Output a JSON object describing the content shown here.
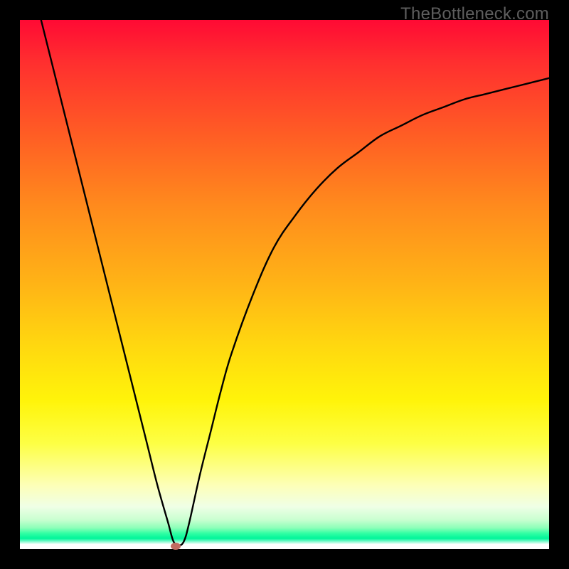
{
  "watermark": "TheBottleneck.com",
  "chart_data": {
    "type": "line",
    "title": "",
    "xlabel": "",
    "ylabel": "",
    "xlim": [
      0,
      100
    ],
    "ylim": [
      0,
      100
    ],
    "grid": false,
    "series": [
      {
        "name": "bottleneck-curve",
        "x": [
          4,
          6,
          8,
          10,
          12,
          14,
          16,
          18,
          20,
          22,
          24,
          26,
          28,
          29,
          30,
          31,
          32,
          34,
          36,
          38,
          40,
          44,
          48,
          52,
          56,
          60,
          64,
          68,
          72,
          76,
          80,
          84,
          88,
          92,
          96,
          100
        ],
        "y": [
          100,
          92,
          84,
          76,
          68,
          60,
          52,
          44,
          36,
          28,
          20,
          12,
          5,
          1.5,
          0.7,
          1.5,
          5,
          14,
          22,
          30,
          37,
          48,
          57,
          63,
          68,
          72,
          75,
          78,
          80,
          82,
          83.5,
          85,
          86,
          87,
          88,
          89
        ]
      }
    ],
    "marker": {
      "x": 29.5,
      "y": 0.6
    },
    "colors": {
      "curve": "#000000",
      "marker": "#c16b61",
      "gradient_top": "#ff0a34",
      "gradient_mid": "#ffd90f",
      "gradient_bottom": "#00f59a",
      "base_band": "#ffffff"
    }
  }
}
